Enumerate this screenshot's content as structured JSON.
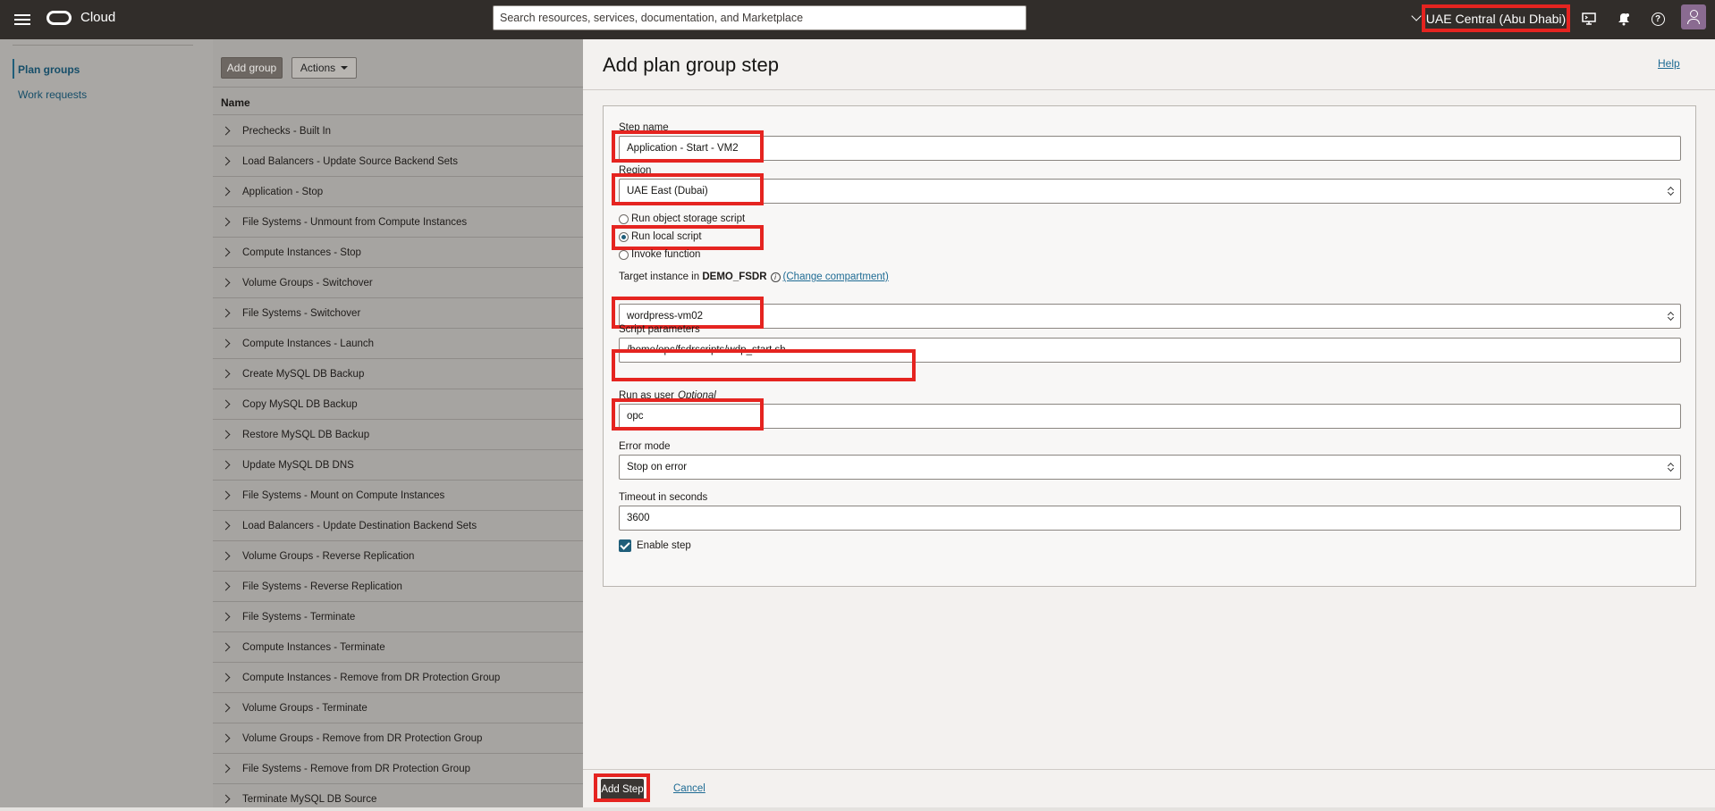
{
  "header": {
    "logo_text": "Cloud",
    "search_placeholder": "Search resources, services, documentation, and Marketplace",
    "region": "UAE Central (Abu Dhabi)",
    "icons": [
      "menu-icon",
      "oracle-logo-icon",
      "region-chevron-icon",
      "cloud-shell-icon",
      "bell-icon",
      "help-icon",
      "user-avatar-icon"
    ]
  },
  "leftnav": {
    "items": [
      {
        "label": "Plan groups",
        "active": true
      },
      {
        "label": "Work requests",
        "active": false
      }
    ]
  },
  "table": {
    "add_group_label": "Add group",
    "actions_label": "Actions",
    "column_name": "Name",
    "rows": [
      "Prechecks - Built In",
      "Load Balancers - Update Source Backend Sets",
      "Application - Stop",
      "File Systems - Unmount from Compute Instances",
      "Compute Instances - Stop",
      "Volume Groups - Switchover",
      "File Systems - Switchover",
      "Compute Instances - Launch",
      "Create MySQL DB Backup",
      "Copy MySQL DB Backup",
      "Restore MySQL DB Backup",
      "Update MySQL DB DNS",
      "File Systems - Mount on Compute Instances",
      "Load Balancers - Update Destination Backend Sets",
      "Volume Groups - Reverse Replication",
      "File Systems - Reverse Replication",
      "File Systems - Terminate",
      "Compute Instances - Terminate",
      "Compute Instances - Remove from DR Protection Group",
      "Volume Groups - Terminate",
      "Volume Groups - Remove from DR Protection Group",
      "File Systems - Remove from DR Protection Group",
      "Terminate MySQL DB Source"
    ]
  },
  "panel": {
    "title": "Add plan group step",
    "help_label": "Help",
    "step_name_label": "Step name",
    "step_name_value": "Application - Start - VM2",
    "region_label": "Region",
    "region_value": "UAE East (Dubai)",
    "radio_options": [
      {
        "label": "Run object storage script",
        "selected": false
      },
      {
        "label": "Run local script",
        "selected": true
      },
      {
        "label": "Invoke function",
        "selected": false
      }
    ],
    "target_label_prefix": "Target instance in",
    "target_compartment": "DEMO_FSDR",
    "change_compartment_label": "(Change compartment)",
    "target_value": "wordpress-vm02",
    "script_params_label": "Script parameters",
    "script_params_value": "/home/opc/fsdrscripts/wdp_start.sh",
    "run_as_label": "Run as user",
    "run_as_optional": "Optional",
    "run_as_value": "opc",
    "error_mode_label": "Error mode",
    "error_mode_value": "Stop on error",
    "timeout_label": "Timeout in seconds",
    "timeout_value": "3600",
    "enable_step_label": "Enable step",
    "enable_step_checked": true,
    "add_step_label": "Add Step",
    "cancel_label": "Cancel"
  },
  "colors": {
    "header_bg": "#312d2a",
    "highlight": "#e52420",
    "link": "#1e6b94",
    "accent": "#1f5e7a"
  }
}
